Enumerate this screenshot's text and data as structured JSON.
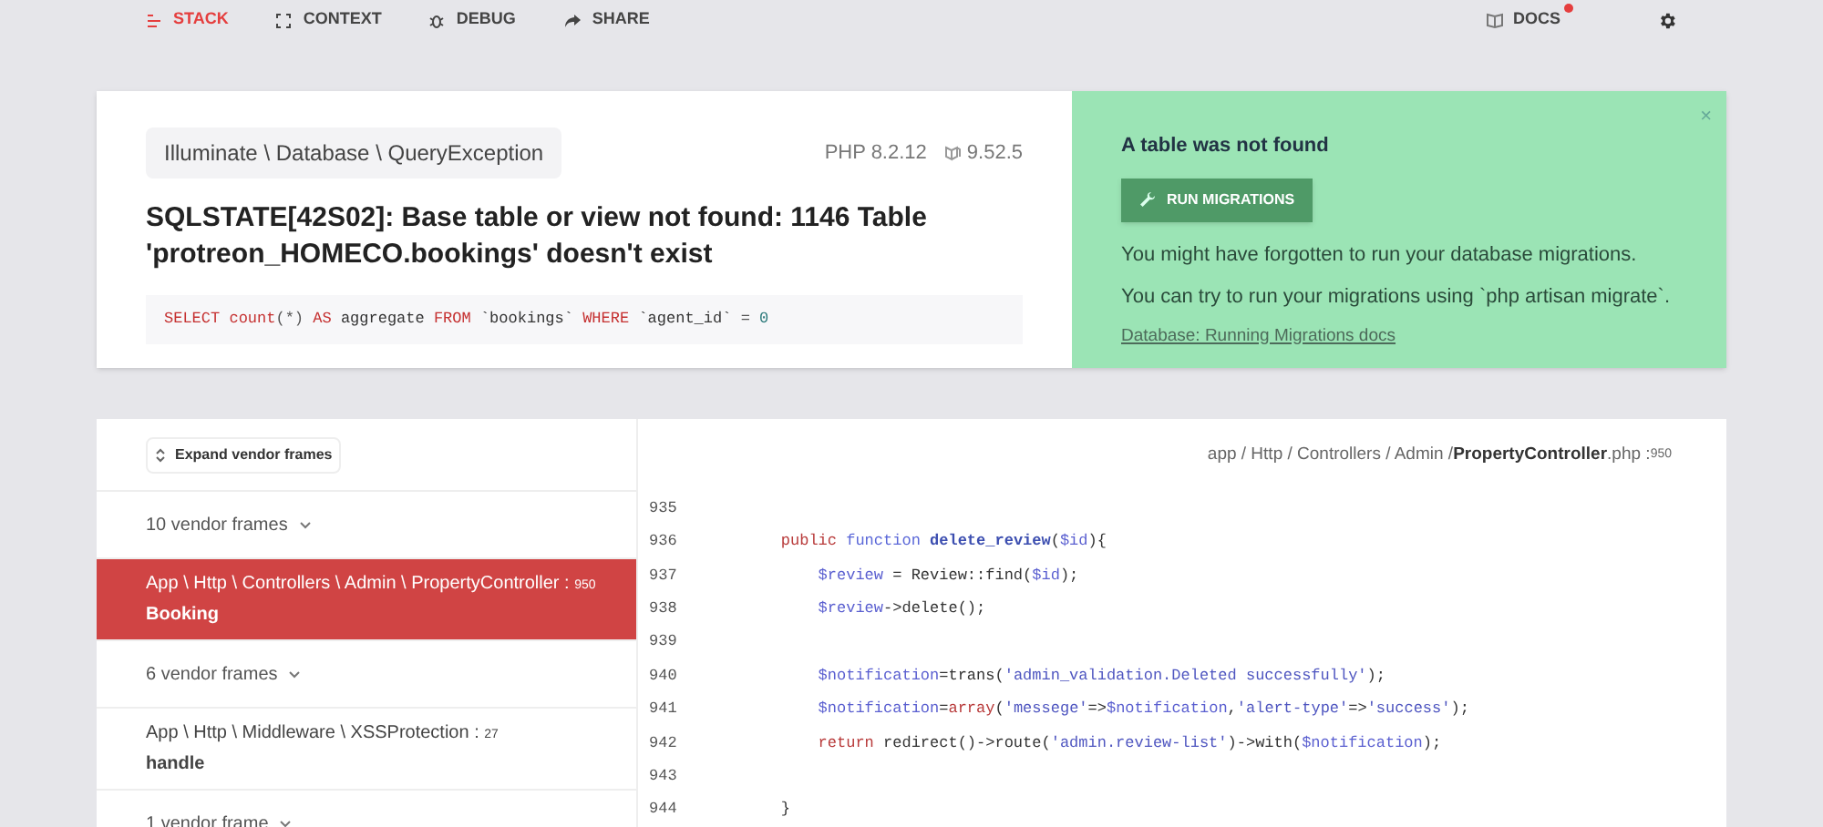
{
  "nav": {
    "tabs": [
      {
        "label": "STACK",
        "selected": true
      },
      {
        "label": "CONTEXT",
        "selected": false
      },
      {
        "label": "DEBUG",
        "selected": false
      },
      {
        "label": "SHARE",
        "selected": false
      }
    ],
    "docs": {
      "label": "DOCS",
      "notification": true
    }
  },
  "exception": {
    "class": "Illuminate \\ Database \\ QueryException",
    "php_version": "PHP 8.2.12",
    "laravel_version": "9.52.5",
    "message": "SQLSTATE[42S02]: Base table or view not found: 1146 Table 'protreon_HOMECO.bookings' doesn't exist",
    "query": [
      {
        "kind": "keyword",
        "text": "SELECT "
      },
      {
        "kind": "keyword",
        "text": "count"
      },
      {
        "kind": "punct",
        "text": "(*) "
      },
      {
        "kind": "keyword",
        "text": "AS"
      },
      {
        "kind": "plain",
        "text": " aggregate "
      },
      {
        "kind": "keyword",
        "text": "FROM"
      },
      {
        "kind": "plain",
        "text": " `bookings` "
      },
      {
        "kind": "keyword",
        "text": "WHERE"
      },
      {
        "kind": "plain",
        "text": " `agent_id` "
      },
      {
        "kind": "punct",
        "text": "= "
      },
      {
        "kind": "number",
        "text": "0"
      }
    ]
  },
  "solution": {
    "close": "×",
    "title": "A table was not found",
    "button": "RUN MIGRATIONS",
    "lines": [
      "You might have forgotten to run your database migrations.",
      "You can try to run your migrations using `php artisan migrate`."
    ],
    "link": "Database: Running Migrations docs"
  },
  "stack": {
    "expand_button": "Expand vendor frames",
    "frames": [
      {
        "kind": "vendor",
        "label": "10 vendor frames"
      },
      {
        "kind": "app",
        "class": "App \\ Http \\ Controllers \\ Admin \\ PropertyController :",
        "line": "950",
        "method": "Booking",
        "selected": true
      },
      {
        "kind": "vendor",
        "label": "6 vendor frames"
      },
      {
        "kind": "app",
        "class": "App \\ Http \\ Middleware \\ XSSProtection :",
        "line": "27",
        "method": "handle",
        "selected": false
      },
      {
        "kind": "vendor",
        "label": "1 vendor frame"
      }
    ]
  },
  "code": {
    "path": "app / Http / Controllers / Admin / ",
    "file": "PropertyController",
    "ext": ".php :",
    "line": "950",
    "lines": [
      {
        "number": "935"
      },
      {
        "number": "936",
        "tokens": [
          {
            "kind": "keyword",
            "text": "    public "
          },
          {
            "kind": "type",
            "text": "function "
          },
          {
            "kind": "function",
            "text": "delete_review"
          },
          {
            "kind": "plain",
            "text": "("
          },
          {
            "kind": "variable",
            "text": "$id"
          },
          {
            "kind": "plain",
            "text": "){"
          }
        ]
      },
      {
        "number": "937",
        "tokens": [
          {
            "kind": "variable",
            "text": "        $review"
          },
          {
            "kind": "plain",
            "text": " = Review::find("
          },
          {
            "kind": "variable",
            "text": "$id"
          },
          {
            "kind": "plain",
            "text": ");"
          }
        ]
      },
      {
        "number": "938",
        "tokens": [
          {
            "kind": "variable",
            "text": "        $review"
          },
          {
            "kind": "plain",
            "text": "->delete();"
          }
        ]
      },
      {
        "number": "939"
      },
      {
        "number": "940",
        "tokens": [
          {
            "kind": "variable",
            "text": "        $notification"
          },
          {
            "kind": "plain",
            "text": "=trans("
          },
          {
            "kind": "string",
            "text": "'admin_validation.Deleted successfully'"
          },
          {
            "kind": "plain",
            "text": ");"
          }
        ]
      },
      {
        "number": "941",
        "tokens": [
          {
            "kind": "variable",
            "text": "        $notification"
          },
          {
            "kind": "plain",
            "text": "="
          },
          {
            "kind": "keyword",
            "text": "array"
          },
          {
            "kind": "plain",
            "text": "("
          },
          {
            "kind": "string",
            "text": "'messege'"
          },
          {
            "kind": "plain",
            "text": "=>"
          },
          {
            "kind": "variable",
            "text": "$notification"
          },
          {
            "kind": "plain",
            "text": ","
          },
          {
            "kind": "string",
            "text": "'alert-type'"
          },
          {
            "kind": "plain",
            "text": "=>"
          },
          {
            "kind": "string",
            "text": "'success'"
          },
          {
            "kind": "plain",
            "text": ");"
          }
        ]
      },
      {
        "number": "942",
        "tokens": [
          {
            "kind": "keyword",
            "text": "        return"
          },
          {
            "kind": "plain",
            "text": " redirect()->route("
          },
          {
            "kind": "string",
            "text": "'admin.review-list'"
          },
          {
            "kind": "plain",
            "text": ")->with("
          },
          {
            "kind": "variable",
            "text": "$notification"
          },
          {
            "kind": "plain",
            "text": ");"
          }
        ]
      },
      {
        "number": "943"
      },
      {
        "number": "944",
        "tokens": [
          {
            "kind": "plain",
            "text": "    }"
          }
        ]
      }
    ]
  }
}
